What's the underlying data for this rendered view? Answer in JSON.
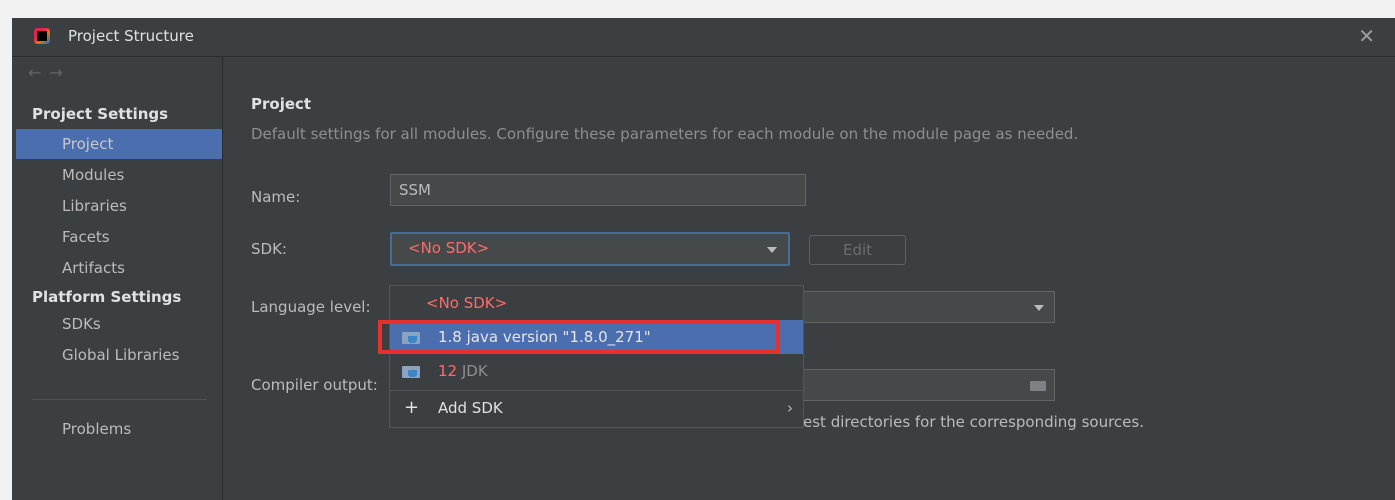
{
  "window": {
    "title": "Project Structure",
    "close_glyph": "✕"
  },
  "nav": {
    "back": "←",
    "forward": "→"
  },
  "sidebar": {
    "project_settings": "Project Settings",
    "items_project": [
      "Project",
      "Modules",
      "Libraries",
      "Facets",
      "Artifacts"
    ],
    "platform_settings": "Platform Settings",
    "items_platform": [
      "SDKs",
      "Global Libraries"
    ],
    "problems": "Problems",
    "selected": "Project"
  },
  "main": {
    "heading": "Project",
    "description": "Default settings for all modules. Configure these parameters for each module on the module page as needed.",
    "name_label": "Name:",
    "name_value": "SSM",
    "sdk_label": "SDK:",
    "sdk_value": "<No SDK>",
    "edit_label": "Edit",
    "language_level_label": "Language level:",
    "compiler_output_label": "Compiler output:",
    "compiler_hint_tail": "est directories for the corresponding sources."
  },
  "dropdown": {
    "no_sdk": "<No SDK>",
    "options": [
      {
        "version": "1.8",
        "detail": "java version \"1.8.0_271\"",
        "highlighted": true
      },
      {
        "version": "12",
        "detail": "JDK",
        "highlighted": false
      }
    ],
    "add_sdk": "Add SDK",
    "add_sdk_glyph": "+",
    "submenu_glyph": "›"
  },
  "colors": {
    "selection": "#4b6eaf",
    "no_sdk_red": "#ff6b6b",
    "highlight_box": "#e8312f"
  },
  "icons": [
    "app-icon",
    "close-icon",
    "back-arrow-icon",
    "forward-arrow-icon",
    "chevron-down-icon",
    "folder-icon",
    "jdk-folder-icon",
    "plus-icon",
    "chevron-right-icon"
  ]
}
